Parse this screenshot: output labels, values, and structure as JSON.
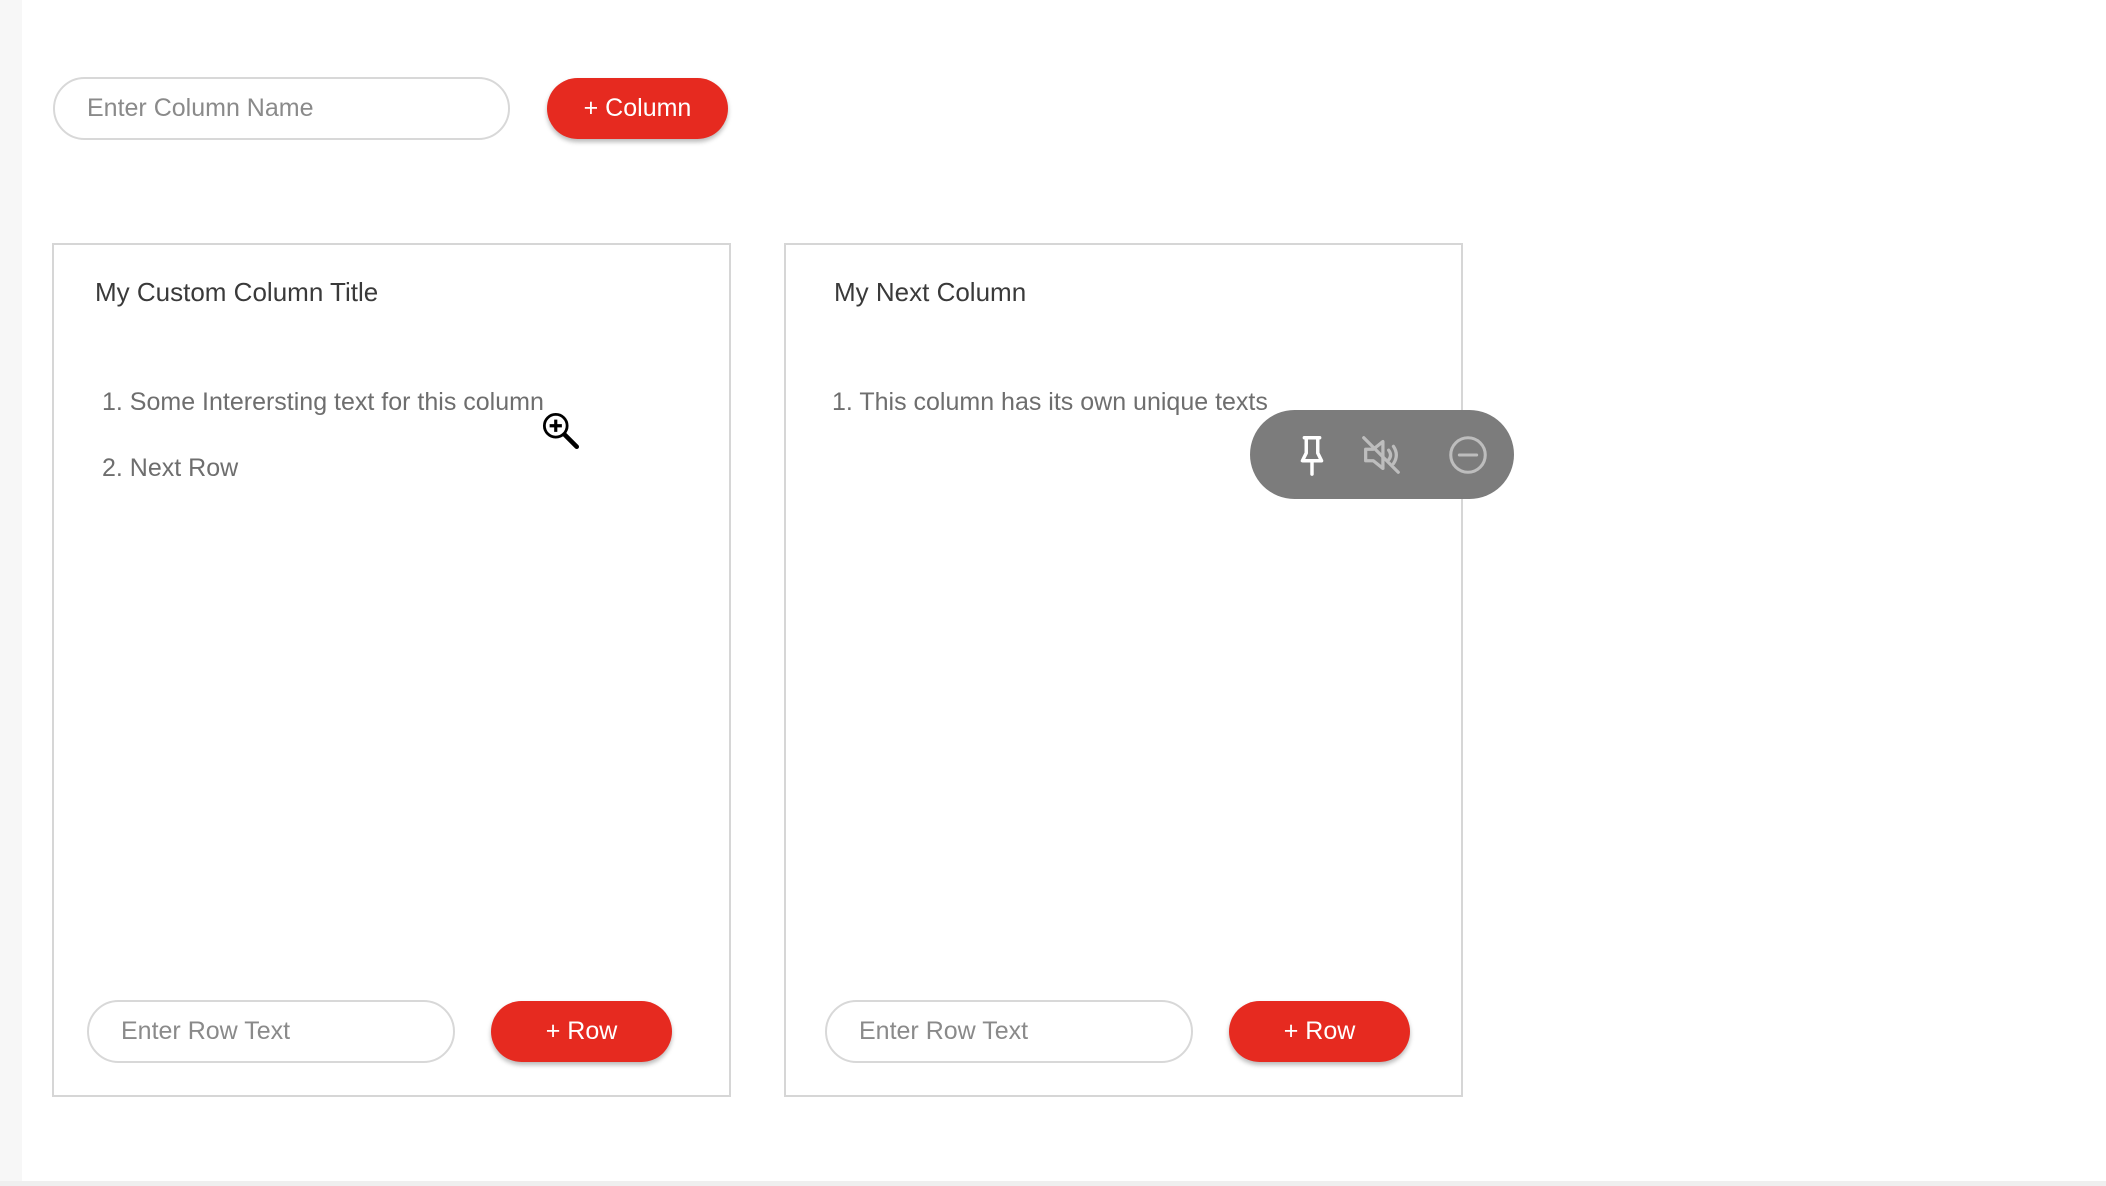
{
  "header": {
    "column_name_placeholder": "Enter Column Name",
    "add_column_label": "+ Column"
  },
  "columns": [
    {
      "title": "My Custom Column Title",
      "rows": [
        "1. Some Interersting text for this column",
        "2. Next Row"
      ],
      "row_input_placeholder": "Enter Row Text",
      "add_row_label": "+ Row"
    },
    {
      "title": "My Next Column",
      "rows": [
        "1. This column has its own unique texts"
      ],
      "row_input_placeholder": "Enter Row Text",
      "add_row_label": "+ Row"
    }
  ],
  "toolbar": {
    "icons": [
      "pin-icon",
      "mute-icon",
      "minimize-icon"
    ]
  },
  "colors": {
    "accent": "#e62a20",
    "toolbar_bg": "#7c7c7c",
    "border": "#d6d6d6"
  }
}
